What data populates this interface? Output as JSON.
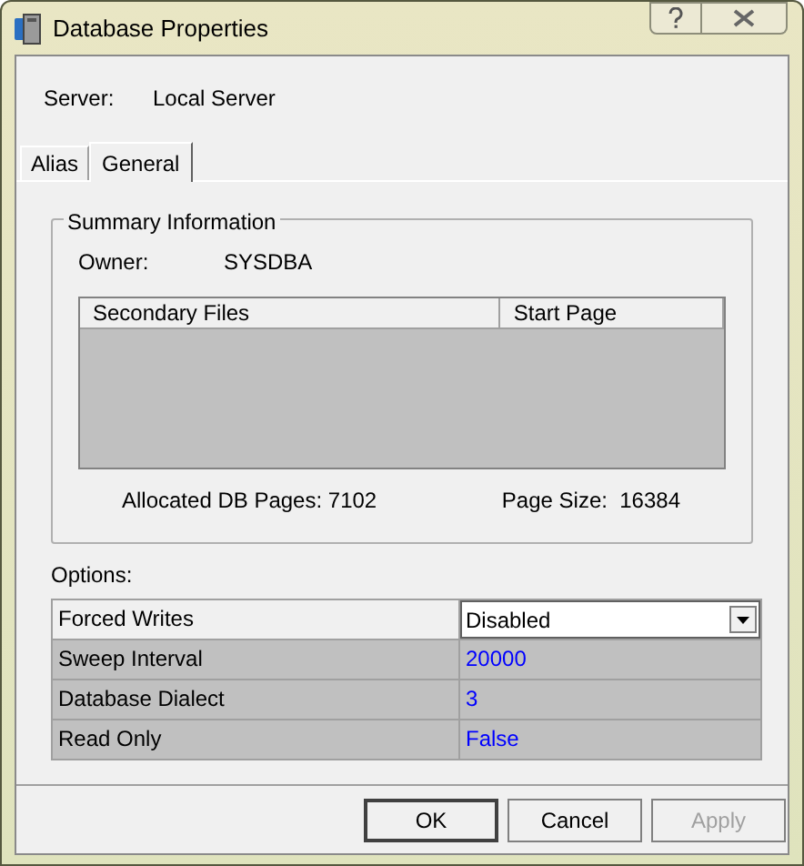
{
  "window": {
    "title": "Database Properties"
  },
  "server": {
    "label": "Server:",
    "value": "Local Server"
  },
  "tabs": [
    {
      "label": "Alias",
      "selected": false
    },
    {
      "label": "General",
      "selected": true
    }
  ],
  "summary": {
    "title": "Summary Information",
    "owner_label": "Owner:",
    "owner": "SYSDBA",
    "files_table": {
      "columns": [
        "Secondary Files",
        "Start Page"
      ]
    },
    "allocated": "Allocated DB Pages: 7102",
    "page_size": "Page Size:  16384"
  },
  "options": {
    "label": "Options:",
    "rows": [
      {
        "name": "Forced Writes",
        "value": "Disabled",
        "kind": "dropdown",
        "selected": true
      },
      {
        "name": "Sweep Interval",
        "value": "20000",
        "kind": "text",
        "selected": false
      },
      {
        "name": "Database Dialect",
        "value": "3",
        "kind": "text",
        "selected": false
      },
      {
        "name": "Read Only",
        "value": "False",
        "kind": "text",
        "selected": false
      }
    ]
  },
  "buttons": [
    {
      "label": "OK",
      "disabled": false,
      "default": true
    },
    {
      "label": "Cancel",
      "disabled": false,
      "default": false
    },
    {
      "label": "Apply",
      "disabled": true,
      "default": false
    }
  ]
}
